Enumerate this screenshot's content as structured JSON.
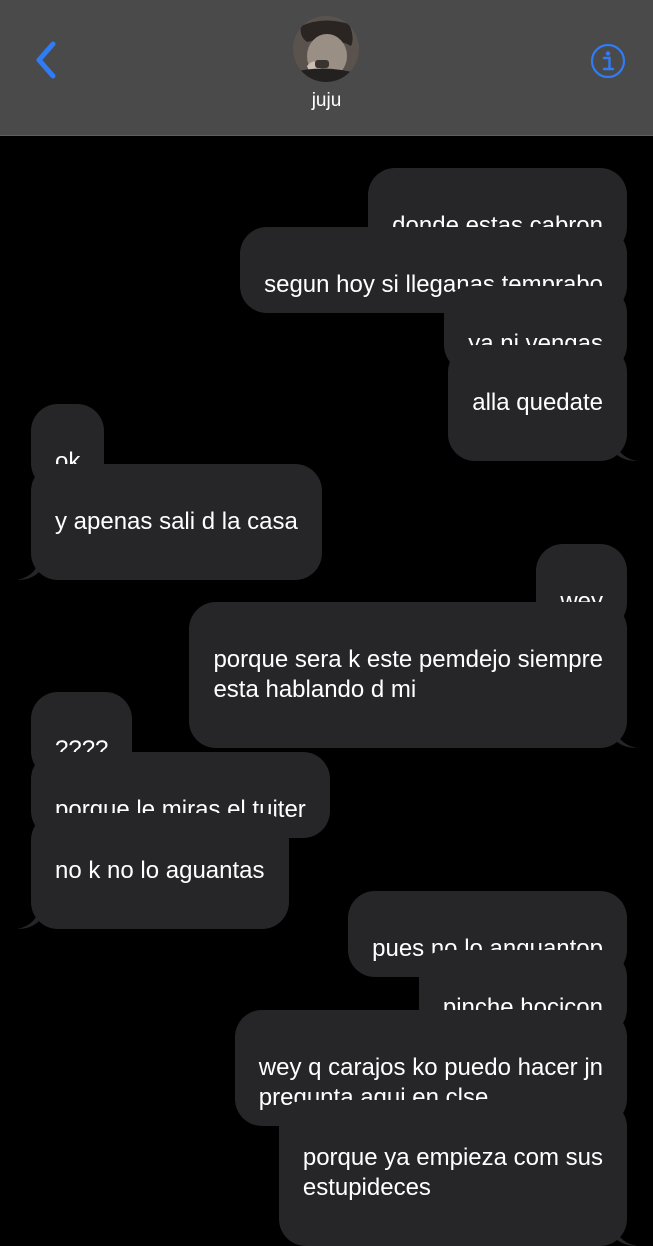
{
  "header": {
    "contact_name": "juju",
    "back_icon": "chevron-left-icon",
    "info_icon": "info-icon",
    "accent_color": "#2f7cf6"
  },
  "messages": [
    {
      "direction": "out",
      "text": "donde estas cabron"
    },
    {
      "direction": "out",
      "text": "segun hoy si lleganas temprabo"
    },
    {
      "direction": "out",
      "text": "ya ni vengas"
    },
    {
      "direction": "out",
      "text": "alla quedate"
    },
    {
      "direction": "in",
      "text": "ok"
    },
    {
      "direction": "in",
      "text": "y apenas sali d la casa"
    },
    {
      "direction": "out",
      "text": "wey"
    },
    {
      "direction": "out",
      "text": "porque sera k este pemdejo siempre\nesta hablando d mi"
    },
    {
      "direction": "in",
      "text": "????"
    },
    {
      "direction": "in",
      "text": "porque le miras el tuiter"
    },
    {
      "direction": "in",
      "text": "no k no lo aguantas"
    },
    {
      "direction": "out",
      "text": "pues no lo anguantop"
    },
    {
      "direction": "out",
      "text": "pinche hocicon"
    },
    {
      "direction": "out",
      "text": "wey q carajos ko puedo hacer jn\npregunta aqui en clse"
    },
    {
      "direction": "out",
      "text": "porque ya empieza com sus\nestupideces"
    }
  ]
}
